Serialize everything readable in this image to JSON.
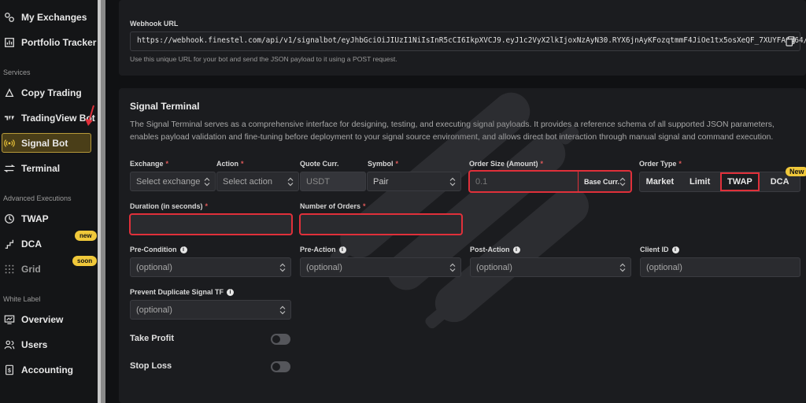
{
  "sidebar": {
    "items_top": [
      {
        "label": "My Exchanges",
        "icon": "exchanges-icon"
      },
      {
        "label": "Portfolio Tracker",
        "icon": "portfolio-icon"
      }
    ],
    "services_label": "Services",
    "services": [
      {
        "label": "Copy Trading",
        "icon": "copy-trading-icon"
      },
      {
        "label": "TradingView Bot",
        "icon": "tradingview-icon"
      },
      {
        "label": "Signal Bot",
        "icon": "signal-icon"
      },
      {
        "label": "Terminal",
        "icon": "terminal-icon"
      }
    ],
    "advanced_label": "Advanced Executions",
    "advanced": [
      {
        "label": "TWAP",
        "icon": "clock-icon"
      },
      {
        "label": "DCA",
        "icon": "dca-icon",
        "badge": "new"
      },
      {
        "label": "Grid",
        "icon": "grid-icon",
        "badge": "soon"
      }
    ],
    "white_label_label": "White Label",
    "white_label": [
      {
        "label": "Overview",
        "icon": "overview-icon"
      },
      {
        "label": "Users",
        "icon": "users-icon"
      },
      {
        "label": "Accounting",
        "icon": "accounting-icon"
      }
    ]
  },
  "webhook": {
    "label": "Webhook URL",
    "url": "https://webhook.finestel.com/api/v1/signalbot/eyJhbGciOiJIUzI1NiIsInR5cCI6IkpXVCJ9.eyJ1c2VyX2lkIjoxNzAyN30.RYX6jnAyKFozqtmmF4JiOe1tx5osXeQF_7XUYFA6d64/",
    "help": "Use this unique URL for your bot and send the JSON payload to it using a POST request."
  },
  "terminal": {
    "title": "Signal Terminal",
    "desc1": "The Signal Terminal serves as a comprehensive interface for designing, testing, and executing signal payloads. It provides a reference schema of all supported JSON parameters,",
    "desc2": "enables payload validation and fine-tuning before deployment to your signal source environment, and allows direct bot interaction through manual signal and command execution.",
    "exchange_label": "Exchange",
    "exchange_placeholder": "Select exchange",
    "action_label": "Action",
    "action_placeholder": "Select action",
    "quote_label": "Quote Curr.",
    "quote_value": "USDT",
    "symbol_label": "Symbol",
    "symbol_value": "Pair",
    "order_size_label": "Order Size (Amount)",
    "order_size_value": "0.1",
    "order_size_unit": "Base Curr.",
    "order_type_label": "Order Type",
    "order_types": [
      "Market",
      "Limit",
      "TWAP",
      "DCA"
    ],
    "order_type_new": "New",
    "duration_label": "Duration (in seconds)",
    "num_orders_label": "Number of Orders",
    "pre_condition_label": "Pre-Condition",
    "pre_action_label": "Pre-Action",
    "post_action_label": "Post-Action",
    "client_id_label": "Client ID",
    "optional": "(optional)",
    "prevent_dup_label": "Prevent Duplicate Signal TF",
    "take_profit_label": "Take Profit",
    "stop_loss_label": "Stop Loss",
    "req": "*",
    "info": "i"
  },
  "colors": {
    "accent": "#f0c83a",
    "highlight": "#e0303a",
    "arrow": "#e0303a"
  }
}
